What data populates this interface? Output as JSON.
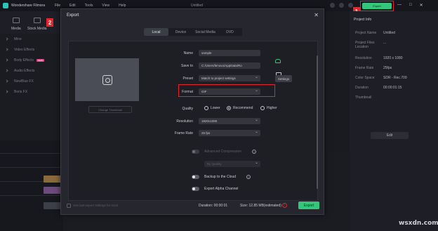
{
  "app": {
    "name": "Wondershare Filmora",
    "doc_title": "Untitled"
  },
  "menu": [
    "File",
    "Edit",
    "Tools",
    "View",
    "Help"
  ],
  "top_export": "Export",
  "badges": {
    "one": "1",
    "two": "2"
  },
  "window_controls": [
    "—",
    "□",
    "✕"
  ],
  "left_tabs": [
    "Media",
    "Stock Media"
  ],
  "left_list": [
    {
      "label": "Mine"
    },
    {
      "label": "Video Effects"
    },
    {
      "label": "Body Effects",
      "badge": "NEW"
    },
    {
      "label": "Audio Effects"
    },
    {
      "label": "NewBlue FX"
    },
    {
      "label": "Boris FX"
    }
  ],
  "right_panel": {
    "tab": "Project Info",
    "rows": [
      {
        "label": "Project Name",
        "value": "Untitled"
      },
      {
        "label": "Project Files Location",
        "value": "..."
      },
      {
        "label": "Resolution",
        "value": "1920 x 1080"
      },
      {
        "label": "Frame Rate",
        "value": "25fps"
      },
      {
        "label": "Color Space",
        "value": "SDR - Rec.709"
      },
      {
        "label": "Duration",
        "value": "00:00:01:15"
      },
      {
        "label": "Thumbnail",
        "value": ""
      }
    ],
    "edit": "Edit"
  },
  "dialog": {
    "title": "Export",
    "close": "✕",
    "tabs": [
      "Local",
      "Device",
      "Social Media",
      "DVD"
    ],
    "active_tab": "Local",
    "thumb_button": "Change Thumbnail",
    "fields": {
      "name": {
        "label": "Name",
        "value": "sample"
      },
      "save_to": {
        "label": "Save to",
        "value": "C:/Users/lenovo/AppData/Ro"
      },
      "preset": {
        "label": "Preset",
        "value": "Match to project settings"
      },
      "settings": "Settings",
      "format": {
        "label": "Format",
        "value": "GIF"
      },
      "quality": {
        "label": "Quality",
        "options": [
          "Lower",
          "Recommend",
          "Higher"
        ],
        "selected": "Recommend"
      },
      "resolution": {
        "label": "Resolution",
        "value": "1920x1080"
      },
      "frame_rate": {
        "label": "Frame Rate",
        "value": "25 fps"
      }
    },
    "advanced": {
      "label": "Advanced Compression",
      "mode": "By Quality"
    },
    "backup": "Backup to the Cloud",
    "alpha": "Export Alpha Channel",
    "footer": {
      "use_last": "Use last export settings for local",
      "duration": "Duration: 00:00:01",
      "size": "Size: 12.85 MB(estimated)",
      "export": "Export"
    }
  },
  "watermark": "wsxdn.com",
  "colors": {
    "accent": "#34c77b",
    "highlight": "#e1262d"
  }
}
